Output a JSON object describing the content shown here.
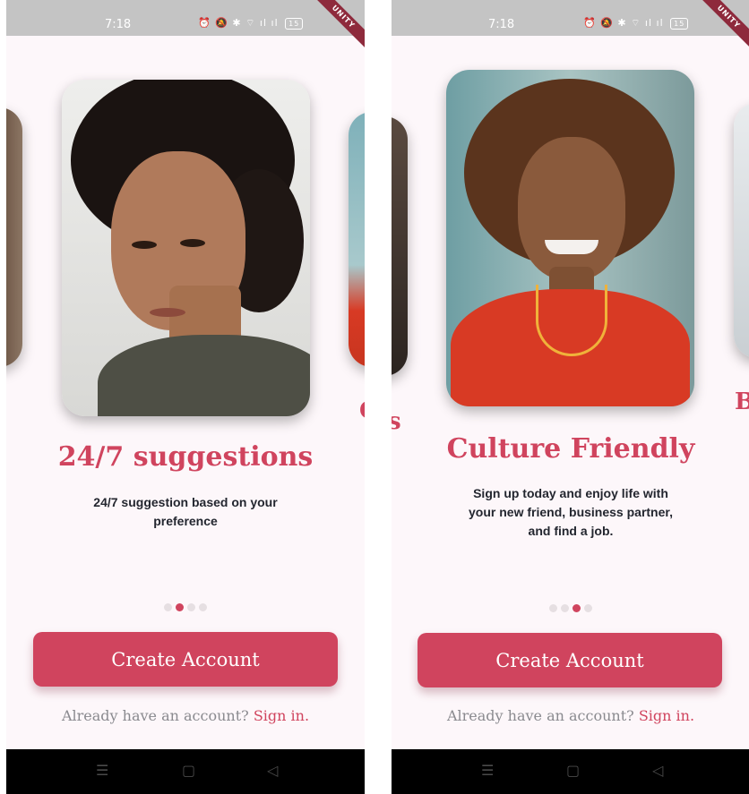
{
  "screens": [
    {
      "status": {
        "time": "7:18",
        "icons": "⏰ 🔕 ✱ ⌔ ıl ıl",
        "battery": "15",
        "banner": "UNITY"
      },
      "card": {
        "subject": "woman with dark curly hair up, olive jacket, neutral look",
        "bg_color": "#e3e3e1",
        "skin_color": "#b07a5b",
        "hair_color": "#1a1311",
        "cloth_color": "#4e4f45"
      },
      "peek": {
        "right_text": "C"
      },
      "slide": {
        "title": "24/7 suggestions",
        "description": "24/7 suggestion based on your preference"
      },
      "pagination": {
        "count": 4,
        "active_index": 1
      },
      "cta": {
        "label": "Create Account"
      },
      "signin": {
        "prompt": "Already have an account? ",
        "link": "Sign in."
      },
      "nav": {
        "menu_icon": "menu-icon",
        "home_icon": "home-icon",
        "back_icon": "back-icon"
      }
    },
    {
      "status": {
        "time": "7:18",
        "icons": "⏰ 🔕 ✱ ⌔ ıl ıl",
        "battery": "15",
        "banner": "UNITY"
      },
      "card": {
        "subject": "smiling woman with curly hair, red embroidered top",
        "bg_color": "#8fb3b6",
        "skin_color": "#8a5a3c",
        "hair_color": "#5b341d",
        "cloth_color": "#d83a24"
      },
      "peek": {
        "left_text": "s",
        "right_text": "B"
      },
      "slide": {
        "title": "Culture Friendly",
        "description": "Sign up today and enjoy life with your new friend, business partner, and find a job."
      },
      "pagination": {
        "count": 4,
        "active_index": 2
      },
      "cta": {
        "label": "Create Account"
      },
      "signin": {
        "prompt": "Already have an account? ",
        "link": "Sign in."
      },
      "nav": {
        "menu_icon": "menu-icon",
        "home_icon": "home-icon",
        "back_icon": "back-icon"
      }
    }
  ],
  "colors": {
    "accent": "#d0445e",
    "background": "#fdf7fa",
    "status_bar": "#c4c4c4",
    "nav_bar": "#000000",
    "dot_inactive": "#e6dfe2"
  }
}
